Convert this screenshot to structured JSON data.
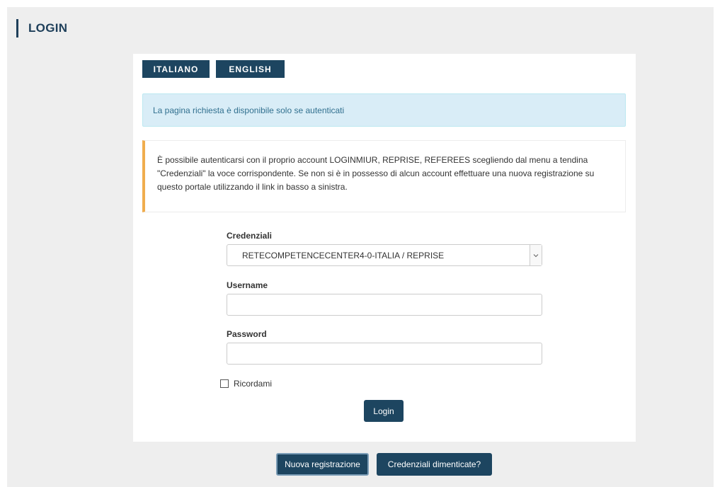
{
  "header": {
    "title": "LOGIN"
  },
  "language": {
    "italian_label": "ITALIANO",
    "english_label": "ENGLISH"
  },
  "info_message": "La pagina richiesta è disponibile solo se autenticati",
  "warning_message": "È possibile autenticarsi con il proprio account LOGINMIUR, REPRISE, REFEREES scegliendo dal menu a tendina \"Credenziali\" la voce corrispondente. Se non si è in possesso di alcun account effettuare una nuova registrazione su questo portale utilizzando il link in basso a sinistra.",
  "form": {
    "credentials_label": "Credenziali",
    "credentials_selected": "RETECOMPETENCECENTER4-0-ITALIA / REPRISE",
    "username_label": "Username",
    "username_value": "",
    "password_label": "Password",
    "password_value": "",
    "remember_label": "Ricordami",
    "remember_checked": false,
    "login_button": "Login"
  },
  "footer": {
    "new_registration_button": "Nuova registrazione",
    "forgot_credentials_button": "Credenziali dimenticate?"
  },
  "colors": {
    "primary": "#1d4560",
    "info_background": "#d9edf7",
    "info_text": "#31708f",
    "warning_accent": "#f0ad4e",
    "page_background": "#eeeeee"
  },
  "icons": {
    "select_arrow": "chevron-down-icon",
    "checkbox": "checkbox-unchecked-icon"
  }
}
